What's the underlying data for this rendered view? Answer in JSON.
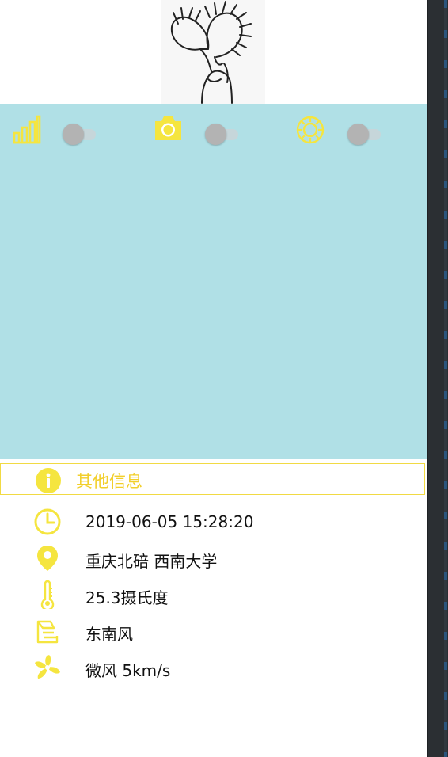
{
  "header": {
    "image_icon": "venus-flytrap-sketch"
  },
  "controls": [
    {
      "icon": "signal-bars-icon",
      "toggle_on": false
    },
    {
      "icon": "camera-icon",
      "toggle_on": false
    },
    {
      "icon": "settings-gear-icon",
      "toggle_on": false
    }
  ],
  "colors": {
    "accent": "#f5e53f",
    "panel": "#b0e0e6",
    "header_text": "#f2cf2b"
  },
  "info": {
    "title": "其他信息",
    "icon": "info-icon",
    "rows": [
      {
        "icon": "clock-icon",
        "text": "2019-06-05 15:28:20"
      },
      {
        "icon": "location-pin-icon",
        "text": "重庆北碚 西南大学"
      },
      {
        "icon": "thermometer-icon",
        "text": "25.3摄氏度"
      },
      {
        "icon": "wind-direction-icon",
        "text": "东南风"
      },
      {
        "icon": "fan-icon",
        "text": "微风 5km/s"
      }
    ]
  }
}
